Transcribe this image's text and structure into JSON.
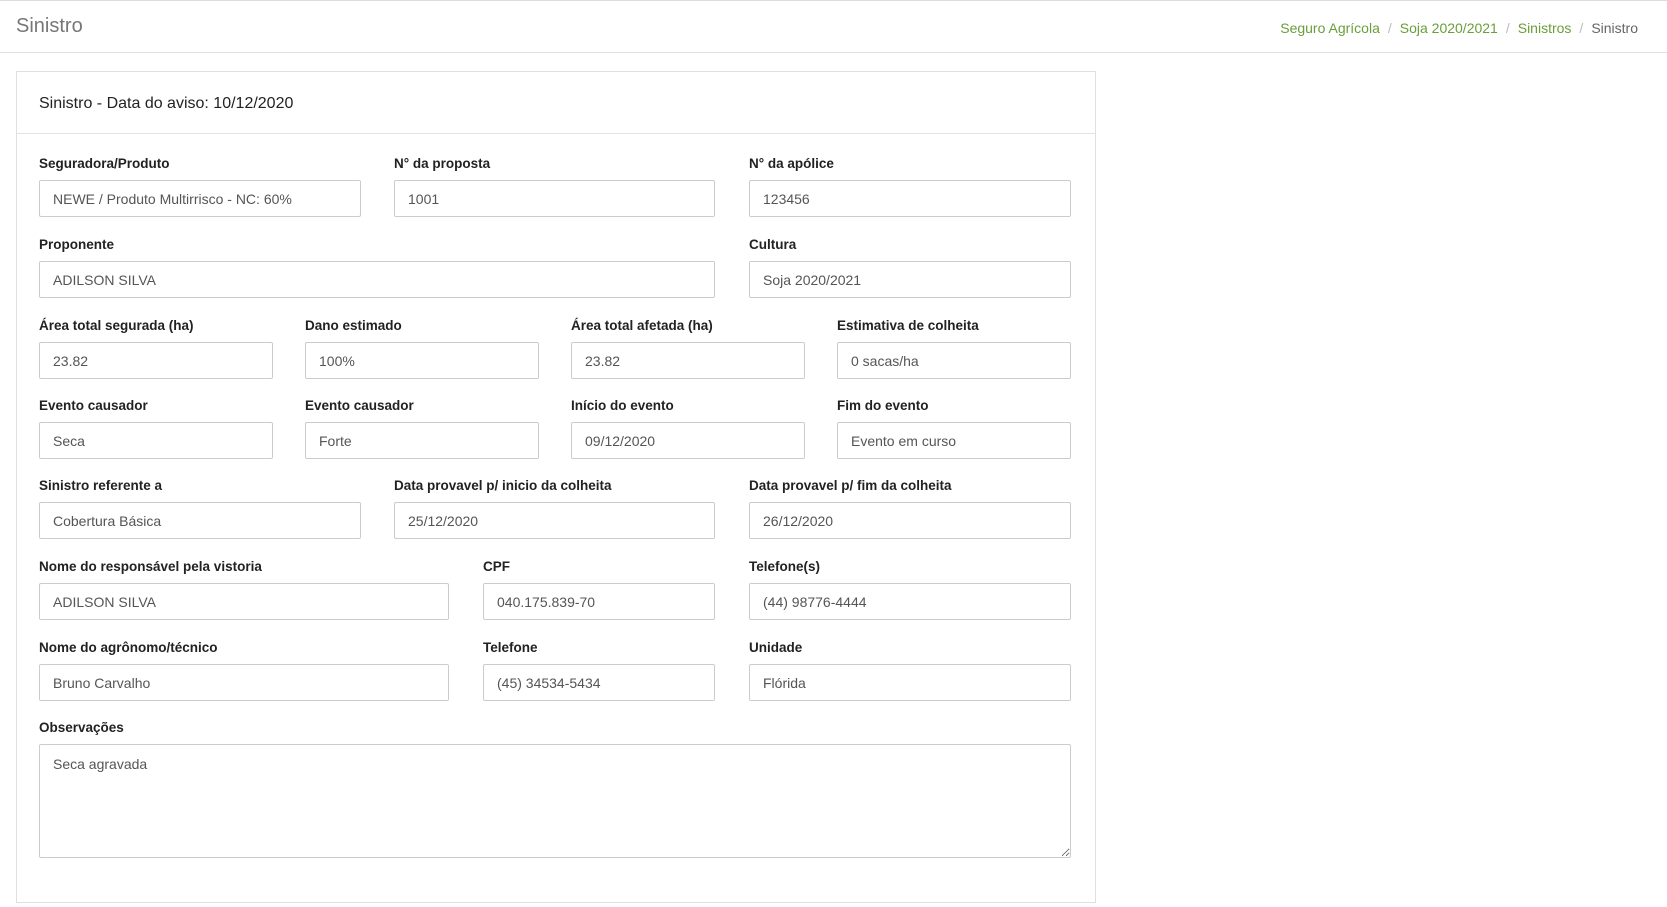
{
  "header": {
    "title": "Sinistro",
    "breadcrumb": [
      "Seguro Agrícola",
      "Soja 2020/2021",
      "Sinistros",
      "Sinistro"
    ]
  },
  "card": {
    "title": "Sinistro - Data do aviso: 10/12/2020"
  },
  "form": {
    "seguradora": {
      "label": "Seguradora/Produto",
      "value": "NEWE / Produto Multirrisco - NC: 60%"
    },
    "proposta": {
      "label": "N° da proposta",
      "value": "1001"
    },
    "apolice": {
      "label": "N° da apólice",
      "value": "123456"
    },
    "proponente": {
      "label": "Proponente",
      "value": "ADILSON SILVA"
    },
    "cultura": {
      "label": "Cultura",
      "value": "Soja 2020/2021"
    },
    "area_segurada": {
      "label": "Área total segurada (ha)",
      "value": "23.82"
    },
    "dano": {
      "label": "Dano estimado",
      "value": "100%"
    },
    "area_afetada": {
      "label": "Área total afetada (ha)",
      "value": "23.82"
    },
    "estimativa": {
      "label": "Estimativa de colheita",
      "value": "0 sacas/ha"
    },
    "evento1": {
      "label": "Evento causador",
      "value": "Seca"
    },
    "evento2": {
      "label": "Evento causador",
      "value": "Forte"
    },
    "inicio_evento": {
      "label": "Início do evento",
      "value": "09/12/2020"
    },
    "fim_evento": {
      "label": "Fim do evento",
      "value": "Evento em curso"
    },
    "sinistro_ref": {
      "label": "Sinistro referente a",
      "value": "Cobertura Básica"
    },
    "inicio_colheita": {
      "label": "Data provavel p/ inicio da colheita",
      "value": "25/12/2020"
    },
    "fim_colheita": {
      "label": "Data provavel p/ fim da colheita",
      "value": "26/12/2020"
    },
    "responsavel": {
      "label": "Nome do responsável pela vistoria",
      "value": "ADILSON SILVA"
    },
    "cpf": {
      "label": "CPF",
      "value": "040.175.839-70"
    },
    "telefones": {
      "label": "Telefone(s)",
      "value": "(44) 98776-4444"
    },
    "agronomo": {
      "label": "Nome do agrônomo/técnico",
      "value": "Bruno Carvalho"
    },
    "telefone": {
      "label": "Telefone",
      "value": "(45) 34534-5434"
    },
    "unidade": {
      "label": "Unidade",
      "value": "Flórida"
    },
    "observacoes": {
      "label": "Observações",
      "value": "Seca agravada"
    }
  },
  "colors": {
    "link": "#6a9e3a",
    "border": "#cccccc"
  }
}
